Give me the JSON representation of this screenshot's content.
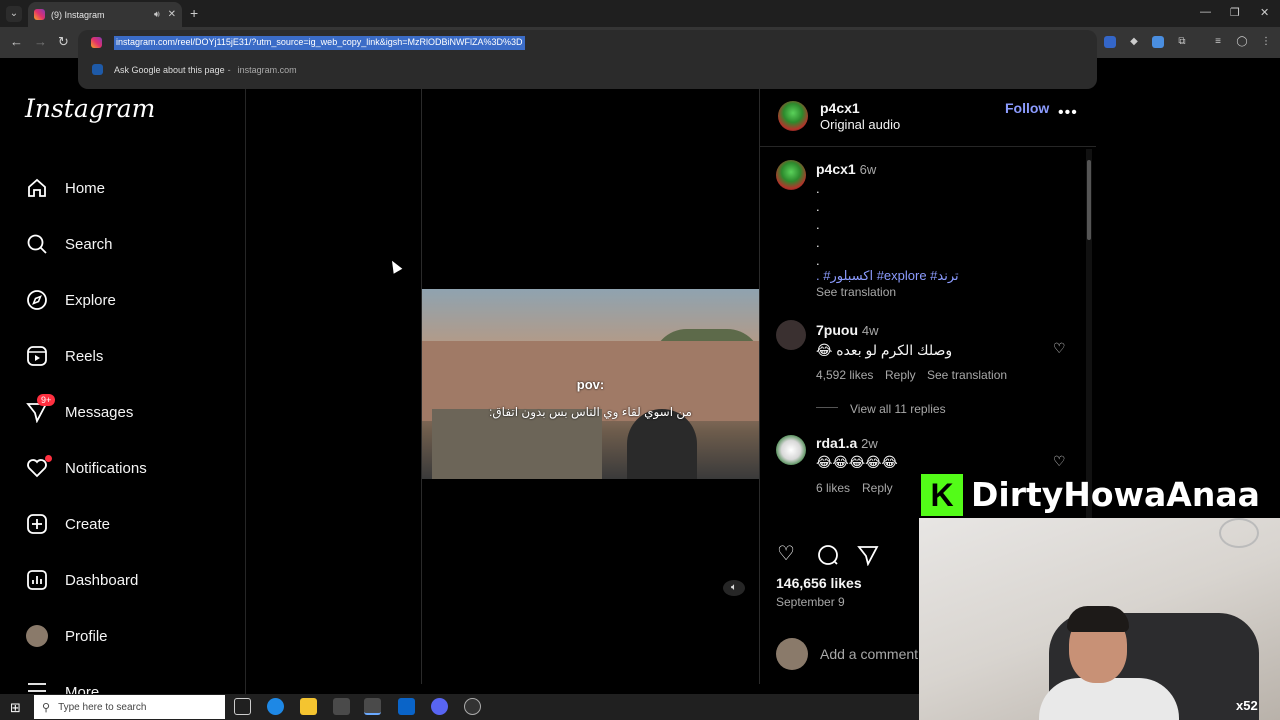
{
  "browser": {
    "tab_title": "(9) Instagram",
    "url": "instagram.com/reel/DOYj115jE31/?utm_source=ig_web_copy_link&igsh=MzRlODBiNWFlZA%3D%3D",
    "suggestion_label": "Ask Google about this page",
    "suggestion_domain": "instagram.com"
  },
  "sidebar": {
    "logo": "Instagram",
    "items": [
      {
        "label": "Home",
        "icon": "home-icon"
      },
      {
        "label": "Search",
        "icon": "search-icon"
      },
      {
        "label": "Explore",
        "icon": "explore-icon"
      },
      {
        "label": "Reels",
        "icon": "reels-icon"
      },
      {
        "label": "Messages",
        "icon": "messages-icon",
        "badge": "9+"
      },
      {
        "label": "Notifications",
        "icon": "heart-icon"
      },
      {
        "label": "Create",
        "icon": "create-icon"
      },
      {
        "label": "Dashboard",
        "icon": "dashboard-icon"
      },
      {
        "label": "Profile",
        "icon": "avatar"
      },
      {
        "label": "More",
        "icon": "menu-icon"
      }
    ]
  },
  "reel": {
    "overlay_top": "pov:",
    "overlay_caption": "من اسوي لقاء وي الناس بس بدون اتفاق:"
  },
  "post": {
    "author": "p4cx1",
    "audio": "Original audio",
    "follow_label": "Follow",
    "caption_author": "p4cx1",
    "caption_age": "6w",
    "caption_dots": [
      ".",
      ".",
      ".",
      ".",
      "."
    ],
    "caption_tags": ". #اكسبلور #explore #ترند",
    "see_translation": "See translation",
    "likes": "146,656 likes",
    "date": "September 9",
    "add_comment": "Add a comment..."
  },
  "comments": [
    {
      "user": "7puou",
      "age": "4w",
      "text": "😂 وصلك الكرم لو بعده",
      "likes": "4,592 likes",
      "reply": "Reply",
      "translate": "See translation",
      "view_replies": "View all 11 replies"
    },
    {
      "user": "rda1.a",
      "age": "2w",
      "text": "😂😂😂😂😂",
      "likes": "6 likes",
      "reply": "Reply"
    }
  ],
  "overlay": {
    "logo_letter": "K",
    "streamer": "DirtyHowaAnaa",
    "multiplier": "x52"
  },
  "taskbar": {
    "search_placeholder": "Type here to search"
  },
  "colors": {
    "accent": "#8c9cff",
    "badge": "#ff3040",
    "kick_green": "#53fc18"
  }
}
